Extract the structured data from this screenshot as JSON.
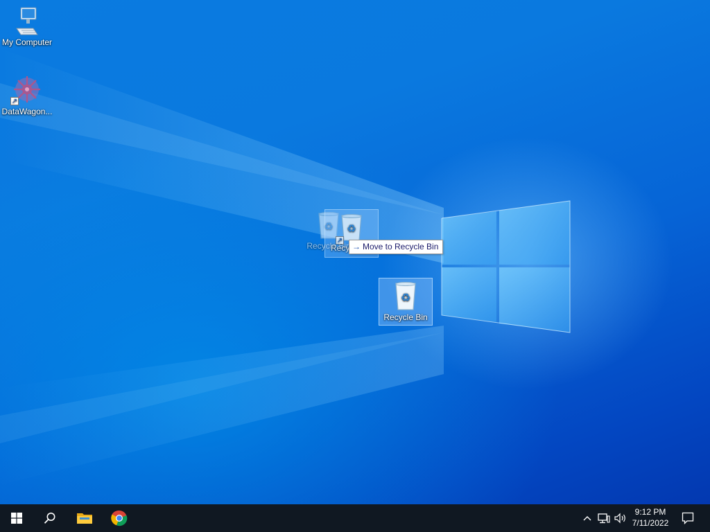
{
  "desktop": {
    "icons": [
      {
        "label": "My Computer",
        "icon": "computer-icon"
      },
      {
        "label": "DataWagon...",
        "icon": "datawagon-app-icon"
      }
    ],
    "drag": {
      "ghost_label_1": "Recycle Bin",
      "ghost_label_2": "Recy"
    },
    "recycle_bin": {
      "label": "Recycle Bin",
      "icon": "recycle-bin-icon"
    },
    "tooltip": {
      "arrow": "→",
      "text": "Move to Recycle Bin"
    }
  },
  "taskbar": {
    "pinned": [
      "start-windows-icon",
      "search-icon",
      "file-explorer-icon",
      "chrome-icon"
    ],
    "tray": [
      "chevron-up-icon",
      "network-icon",
      "volume-icon"
    ],
    "clock": {
      "time": "9:12 PM",
      "date": "7/11/2022"
    },
    "notifications": "action-center-icon"
  },
  "colors": {
    "wallpaper_blue": "#0a79df",
    "taskbar": "#101822",
    "selection": "#a0cdff"
  }
}
